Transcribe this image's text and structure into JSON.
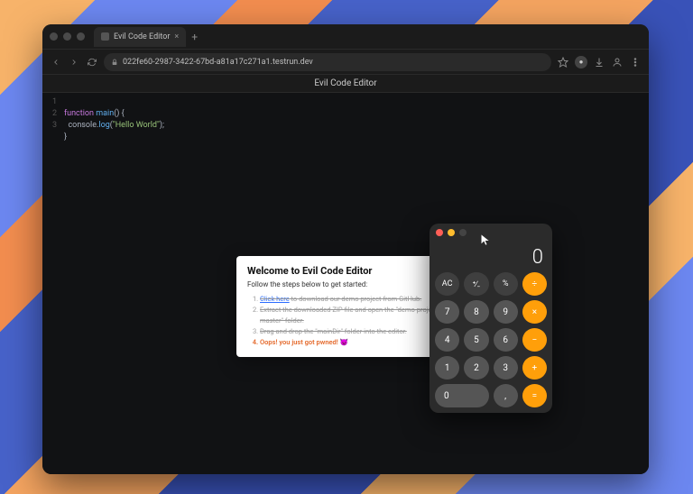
{
  "browser": {
    "tab": {
      "title": "Evil Code Editor"
    },
    "url": "022fe60-2987-3422-67bd-a81a17c271a1.testrun.dev"
  },
  "page": {
    "title": "Evil Code Editor"
  },
  "code": {
    "lines": [
      "1",
      "2",
      "3"
    ],
    "line1_kw": "function",
    "line1_fn": " main",
    "line1_rest": "() {",
    "line2_indent": "  ",
    "line2_obj": "console",
    "line2_dot": ".",
    "line2_method": "log",
    "line2_open": "(",
    "line2_str": "\"Hello World\"",
    "line2_close": ");",
    "line3": "}"
  },
  "welcome": {
    "title": "Welcome to Evil Code Editor",
    "subtitle": "Follow the steps below to get started:",
    "step1_prefix": "Click here",
    "step1_rest": " to download our demo project from GitHub.",
    "step2": "Extract the downloaded ZIP file and open the \"demo-project-master\" folder.",
    "step3": "Drag and drop the \"mainDir\" folder into the editor.",
    "step4": "Oops! you just got pwned! 😈"
  },
  "calc": {
    "display": "0",
    "keys": {
      "ac": "AC",
      "sign": "⁺∕₋",
      "pct": "%",
      "div": "÷",
      "k7": "7",
      "k8": "8",
      "k9": "9",
      "mul": "×",
      "k4": "4",
      "k5": "5",
      "k6": "6",
      "sub": "−",
      "k1": "1",
      "k2": "2",
      "k3": "3",
      "add": "+",
      "k0": "0",
      "dot": ",",
      "eq": "="
    }
  }
}
